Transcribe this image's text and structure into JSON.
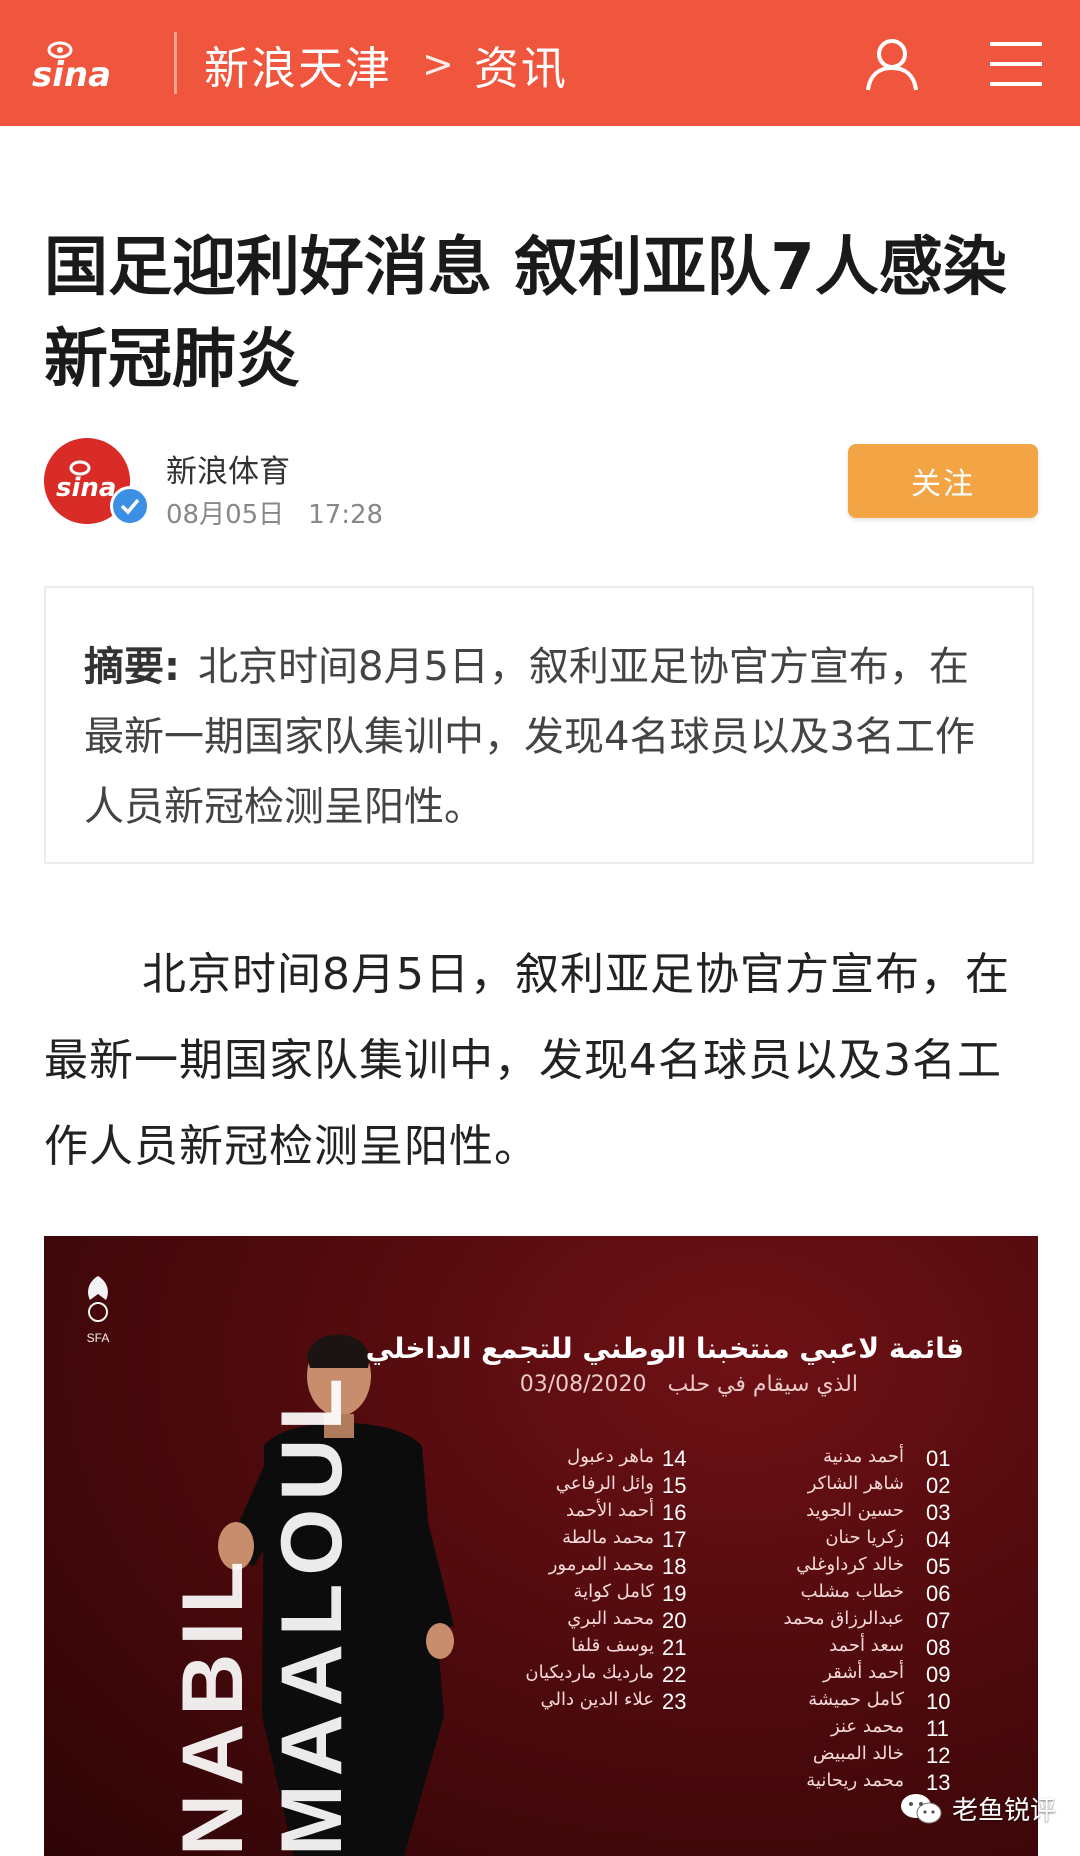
{
  "header": {
    "brand": "sina",
    "crumb_site": "新浪天津",
    "crumb_sep": ">",
    "crumb_section": "资讯",
    "icons": [
      "user-icon",
      "menu-icon"
    ],
    "bg_color": "#f0553d"
  },
  "article": {
    "title": "国足迎利好消息 叙利亚队7人感染新冠肺炎",
    "author": {
      "name": "新浪体育",
      "date": "08月05日",
      "time": "17:28",
      "follow_label": "关注",
      "verified": true
    },
    "summary": {
      "label": "摘要:",
      "text": "北京时间8月5日，叙利亚足协官方宣布，在最新一期国家队集训中，发现4名球员以及3名工作人员新冠检测呈阳性。"
    },
    "body": "北京时间8月5日，叙利亚足协官方宣布，在最新一期国家队集训中，发现4名球员以及3名工作人员新冠检测呈阳性。"
  },
  "photo": {
    "org": "SFA",
    "vertical_name": "NABIL MAALOUL",
    "title_ar": "قائمة لاعبي منتخبنا الوطني للتجمع الداخلي",
    "subtitle_ar": "الذي سيقام في حلب",
    "date": "03/08/2020",
    "left_column": [
      {
        "num": "14",
        "name": "ماهر دعبول"
      },
      {
        "num": "15",
        "name": "وائل الرفاعي"
      },
      {
        "num": "16",
        "name": "أحمد الأحمد"
      },
      {
        "num": "17",
        "name": "محمد مالطة"
      },
      {
        "num": "18",
        "name": "محمد المرمور"
      },
      {
        "num": "19",
        "name": "كامل كواية"
      },
      {
        "num": "20",
        "name": "محمد البري"
      },
      {
        "num": "21",
        "name": "يوسف قلفا"
      },
      {
        "num": "22",
        "name": "ماردیك مارديكيان"
      },
      {
        "num": "23",
        "name": "علاء الدين دالي"
      }
    ],
    "right_column": [
      {
        "num": "01",
        "name": "أحمد مدنية"
      },
      {
        "num": "02",
        "name": "شاهر الشاكر"
      },
      {
        "num": "03",
        "name": "حسين الجويد"
      },
      {
        "num": "04",
        "name": "زكريا حنان"
      },
      {
        "num": "05",
        "name": "خالد كرداوغلي"
      },
      {
        "num": "06",
        "name": "خطاب مشلب"
      },
      {
        "num": "07",
        "name": "عبدالرزاق محمد"
      },
      {
        "num": "08",
        "name": "سعد أحمد"
      },
      {
        "num": "09",
        "name": "أحمد أشقر"
      },
      {
        "num": "10",
        "name": "كامل حميشة"
      },
      {
        "num": "11",
        "name": "محمد عنز"
      },
      {
        "num": "12",
        "name": "خالد المبيض"
      },
      {
        "num": "13",
        "name": "محمد ريحانية"
      }
    ]
  },
  "watermark": {
    "text": "老鱼锐评",
    "icon": "wechat-icon"
  },
  "colors": {
    "accent": "#f0553d",
    "follow": "#f3a546",
    "photo_bg": "#4a090c"
  }
}
